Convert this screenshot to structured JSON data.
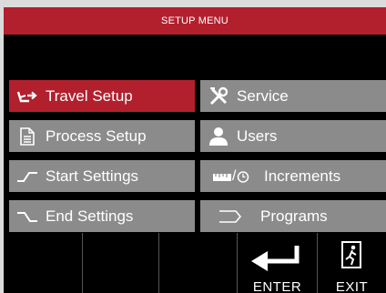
{
  "title": "SETUP MENU",
  "menu_left": [
    {
      "label": "Travel Setup",
      "icon": "travel-setup-icon",
      "selected": true
    },
    {
      "label": "Process Setup",
      "icon": "document-icon",
      "selected": false
    },
    {
      "label": "Start Settings",
      "icon": "start-ramp-icon",
      "selected": false
    },
    {
      "label": "End Settings",
      "icon": "end-ramp-icon",
      "selected": false
    }
  ],
  "menu_right": [
    {
      "label": "Service",
      "icon": "tools-icon",
      "selected": false
    },
    {
      "label": "Users",
      "icon": "user-icon",
      "selected": false
    },
    {
      "label": "Increments",
      "icon": "ruler-timer-icon",
      "selected": false,
      "prefix": "/"
    },
    {
      "label": "Programs",
      "icon": "programs-icon",
      "selected": false
    }
  ],
  "softkeys": {
    "enter_label": "ENTER",
    "exit_label": "EXIT"
  },
  "colors": {
    "accent": "#b2202e",
    "button": "#8b8b8b",
    "background": "#000000",
    "text": "#ffffff"
  }
}
